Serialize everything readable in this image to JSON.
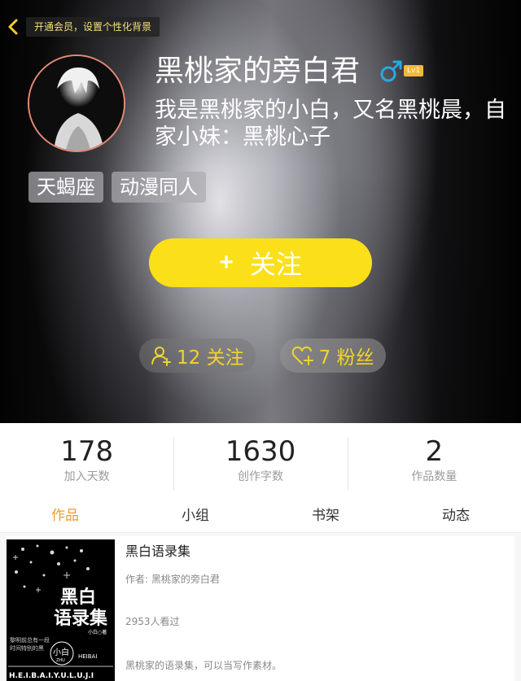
{
  "header": {
    "back_label": "返回",
    "promo_text": "开通会员，设置个性化背景"
  },
  "profile": {
    "username": "黑桃家的旁白君",
    "gender_icon": "male-icon",
    "level": "Lv1",
    "bio": "我是黑桃家的小白，又名黑桃晨，自家小妹：黑桃心子",
    "tags": [
      "天蝎座",
      "动漫同人"
    ],
    "follow_button": {
      "icon": "+",
      "label": "关注"
    },
    "following": "12 关注",
    "followers": "7 粉丝"
  },
  "stats": [
    {
      "value": "178",
      "label": "加入天数"
    },
    {
      "value": "1630",
      "label": "创作字数"
    },
    {
      "value": "2",
      "label": "作品数量"
    }
  ],
  "tabs": [
    {
      "label": "作品",
      "active": true
    },
    {
      "label": "小组",
      "active": false
    },
    {
      "label": "书架",
      "active": false
    },
    {
      "label": "动态",
      "active": false
    }
  ],
  "works": [
    {
      "title": "黑白语录集",
      "author": "作者: 黑桃家的旁白君",
      "views": "2953人看过",
      "description": "黑桃家的语录集，可以当写作素材。",
      "cover": {
        "title_line1": "黑白",
        "title_line2": "语录集",
        "author_mark": "小白○著",
        "side_text_1": "黎明前总有一段",
        "side_text_2": "时间特别的黑",
        "badge_text": "小白",
        "badge_sub": "ZHU",
        "brand": "HEIBAI",
        "footer": "H.E.I.B.A.I.Y.U.L.U.J.I"
      }
    }
  ],
  "colors": {
    "accent": "#f39a2b",
    "follow_yellow": "#fbdf19",
    "count_text": "#f2d42a",
    "promo_text": "#f4e07a",
    "avatar_border": "#e58b73",
    "male_blue": "#2aa8e0"
  }
}
